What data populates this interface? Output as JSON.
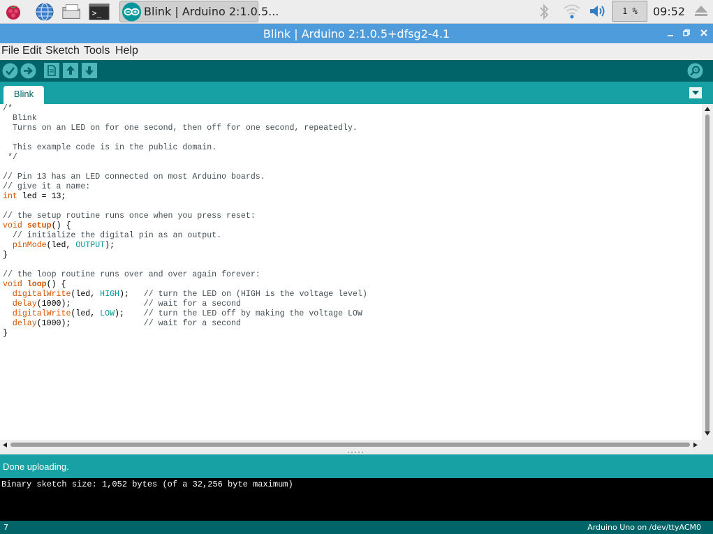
{
  "taskbar": {
    "task_label": "Blink | Arduino 2:1.0.5...",
    "cpu_usage": "1 %",
    "clock": "09:52"
  },
  "window": {
    "title": "Blink | Arduino 2:1.0.5+dfsg2-4.1"
  },
  "menu": {
    "items": [
      "File",
      "Edit",
      "Sketch",
      "Tools",
      "Help"
    ]
  },
  "toolbar": {
    "buttons": [
      "verify",
      "upload",
      "new",
      "open",
      "save",
      "serial-monitor"
    ]
  },
  "tabs": {
    "items": [
      {
        "label": "Blink"
      }
    ]
  },
  "editor": {
    "lines": [
      [
        {
          "t": "/*",
          "c": "cmt"
        }
      ],
      [
        {
          "t": "  Blink",
          "c": "cmt"
        }
      ],
      [
        {
          "t": "  Turns on an LED on for one second, then off for one second, repeatedly.",
          "c": "cmt"
        }
      ],
      [
        {
          "t": "",
          "c": ""
        }
      ],
      [
        {
          "t": "  This example code is in the public domain.",
          "c": "cmt"
        }
      ],
      [
        {
          "t": " */",
          "c": "cmt"
        }
      ],
      [
        {
          "t": "",
          "c": ""
        }
      ],
      [
        {
          "t": "// Pin 13 has an LED connected on most Arduino boards.",
          "c": "cmt"
        }
      ],
      [
        {
          "t": "// give it a name:",
          "c": "cmt"
        }
      ],
      [
        {
          "t": "int",
          "c": "kw"
        },
        {
          "t": " led = 13;",
          "c": ""
        }
      ],
      [
        {
          "t": "",
          "c": ""
        }
      ],
      [
        {
          "t": "// the setup routine runs once when you press reset:",
          "c": "cmt"
        }
      ],
      [
        {
          "t": "void",
          "c": "kw"
        },
        {
          "t": " ",
          "c": ""
        },
        {
          "t": "setup",
          "c": "fnb"
        },
        {
          "t": "() {",
          "c": ""
        }
      ],
      [
        {
          "t": "  // initialize the digital pin as an output.",
          "c": "cmt"
        }
      ],
      [
        {
          "t": "  ",
          "c": ""
        },
        {
          "t": "pinMode",
          "c": "fn"
        },
        {
          "t": "(led, ",
          "c": ""
        },
        {
          "t": "OUTPUT",
          "c": "cst"
        },
        {
          "t": ");",
          "c": ""
        }
      ],
      [
        {
          "t": "}",
          "c": ""
        }
      ],
      [
        {
          "t": "",
          "c": ""
        }
      ],
      [
        {
          "t": "// the loop routine runs over and over again forever:",
          "c": "cmt"
        }
      ],
      [
        {
          "t": "void",
          "c": "kw"
        },
        {
          "t": " ",
          "c": ""
        },
        {
          "t": "loop",
          "c": "fnb"
        },
        {
          "t": "() {",
          "c": ""
        }
      ],
      [
        {
          "t": "  ",
          "c": ""
        },
        {
          "t": "digitalWrite",
          "c": "fn"
        },
        {
          "t": "(led, ",
          "c": ""
        },
        {
          "t": "HIGH",
          "c": "cst"
        },
        {
          "t": ");   ",
          "c": ""
        },
        {
          "t": "// turn the LED on (HIGH is the voltage level)",
          "c": "cmt"
        }
      ],
      [
        {
          "t": "  ",
          "c": ""
        },
        {
          "t": "delay",
          "c": "fn"
        },
        {
          "t": "(1000);               ",
          "c": ""
        },
        {
          "t": "// wait for a second",
          "c": "cmt"
        }
      ],
      [
        {
          "t": "  ",
          "c": ""
        },
        {
          "t": "digitalWrite",
          "c": "fn"
        },
        {
          "t": "(led, ",
          "c": ""
        },
        {
          "t": "LOW",
          "c": "cst"
        },
        {
          "t": ");    ",
          "c": ""
        },
        {
          "t": "// turn the LED off by making the voltage LOW",
          "c": "cmt"
        }
      ],
      [
        {
          "t": "  ",
          "c": ""
        },
        {
          "t": "delay",
          "c": "fn"
        },
        {
          "t": "(1000);               ",
          "c": ""
        },
        {
          "t": "// wait for a second",
          "c": "cmt"
        }
      ],
      [
        {
          "t": "}",
          "c": ""
        }
      ]
    ]
  },
  "status": {
    "message": "Done uploading."
  },
  "console": {
    "text": "Binary sketch size: 1,052 bytes (of a 32,256 byte maximum)"
  },
  "footer": {
    "line_number": "7",
    "board": "Arduino Uno on /dev/ttyACM0"
  },
  "colors": {
    "toolbar_bg": "#006468",
    "tab_bg": "#17a1a5",
    "title_bg": "#4f9cdc",
    "keyword": "#d35400",
    "constant": "#00979c",
    "comment": "#434f54"
  }
}
